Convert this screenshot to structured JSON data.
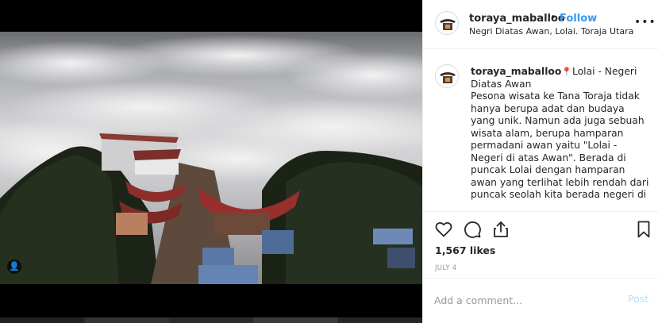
{
  "post": {
    "username": "toraya_maballoo",
    "separator": "•",
    "follow_label": "Follow",
    "location": "Negri Diatas Awan, Lolai. Toraja Utara",
    "more_icon": "more-horizontal-icon",
    "more_label": "•••"
  },
  "caption": {
    "username": "toraya_maballoo",
    "pin_icon": "map-pin-icon",
    "pin_glyph": "📍",
    "text": "Lolai - Negeri Diatas Awan\nPesona wisata ke Tana Toraja tidak hanya berupa adat dan budaya yang unik.  Namun ada juga sebuah wisata alam, berupa hamparan permadani awan yaitu \"Lolai - Negeri di atas Awan\". Berada di puncak Lolai dengan hamparan awan yang terlihat lebih rendah dari puncak seolah kita berada negeri di"
  },
  "actions": {
    "like_icon": "heart-icon",
    "comment_icon": "comment-bubble-icon",
    "share_icon": "share-icon",
    "save_icon": "bookmark-icon"
  },
  "likes": "1,567 likes",
  "date": "JULY 4",
  "comment_box": {
    "placeholder": "Add a comment...",
    "post_label": "Post"
  },
  "photo": {
    "user_tag_icon": "user-tag-icon",
    "user_tag_glyph": "👤"
  },
  "colors": {
    "link_blue": "#3897f0",
    "post_disabled": "#b2dffc",
    "border": "#efefef",
    "text": "#262626",
    "muted": "#999999"
  }
}
